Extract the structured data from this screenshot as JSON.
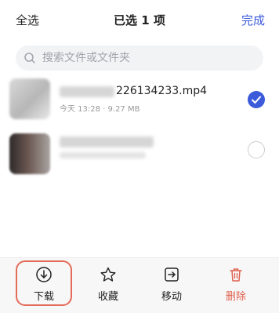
{
  "header": {
    "select_all": "全选",
    "title": "已选 1 项",
    "done": "完成"
  },
  "search": {
    "placeholder": "搜索文件或文件夹",
    "value": ""
  },
  "files": [
    {
      "name_visible": "226134233.mp4",
      "meta": "今天 13:28 · 9.27 MB",
      "selected": true
    },
    {
      "name_visible": "",
      "meta": "",
      "selected": false
    }
  ],
  "toolbar": {
    "download": "下载",
    "favorite": "收藏",
    "move": "移动",
    "delete": "删除"
  },
  "colors": {
    "accent": "#3b5bdb",
    "danger": "#e0604e",
    "highlight": "#e36b5a"
  }
}
